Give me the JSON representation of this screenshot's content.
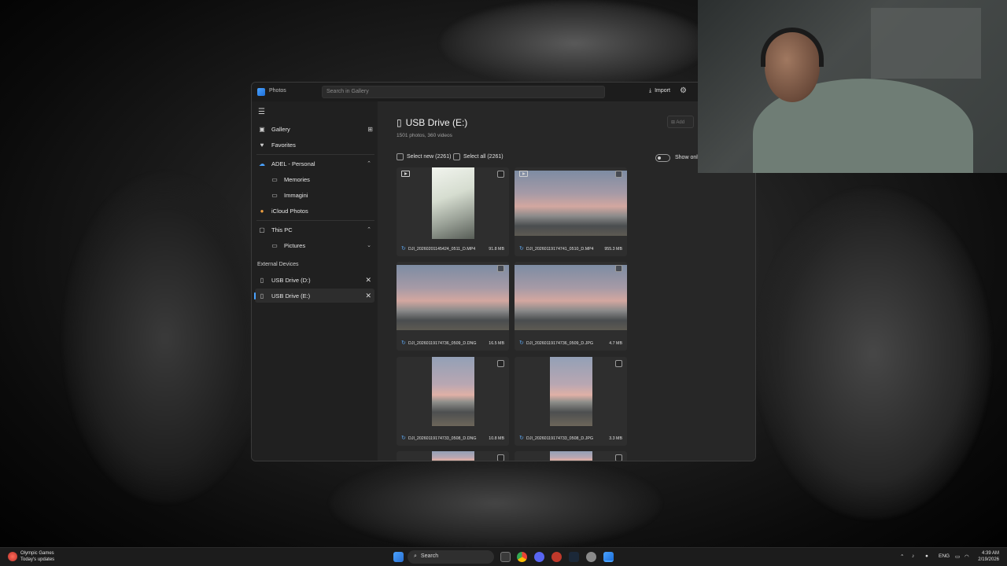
{
  "window": {
    "app_title": "Photos",
    "search_placeholder": "Search in Gallery",
    "import_label": "Import"
  },
  "sidebar": {
    "gallery": "Gallery",
    "favorites": "Favorites",
    "onedrive": "ADEL - Personal",
    "memories": "Memories",
    "immagini": "Immagini",
    "icloud": "iCloud Photos",
    "this_pc": "This PC",
    "pictures": "Pictures",
    "external_header": "External Devices",
    "usb_d": "USB Drive (D:)",
    "usb_e": "USB Drive (E:)"
  },
  "main": {
    "title": "USB Drive (E:)",
    "subtitle": "1501 photos, 360 videos",
    "add_label": "Add",
    "select_new": "Select new (2261)",
    "select_all": "Select all (2261)",
    "show_only": "Show only"
  },
  "tiles": [
    {
      "name": "DJI_20260201145424_0511_D.MP4",
      "size": "91.8 MB"
    },
    {
      "name": "DJI_20260119174741_0510_D.MP4",
      "size": "955.3 MB"
    },
    {
      "name": "DJI_20260119174736_0509_D.DNG",
      "size": "16.5 MB"
    },
    {
      "name": "DJI_20260119174736_0509_D.JPG",
      "size": "4.7 MB"
    },
    {
      "name": "DJI_20260119174733_0508_D.DNG",
      "size": "10.8 MB"
    },
    {
      "name": "DJI_20260119174733_0508_D.JPG",
      "size": "3.3 MB"
    }
  ],
  "taskbar": {
    "weather_title": "Olympic Games",
    "weather_sub": "Today's updates",
    "search_label": "Search",
    "lang": "ENG",
    "time": "4:39 AM",
    "date": "2/19/2026"
  },
  "colors": {
    "accent": "#4aa3ff"
  }
}
